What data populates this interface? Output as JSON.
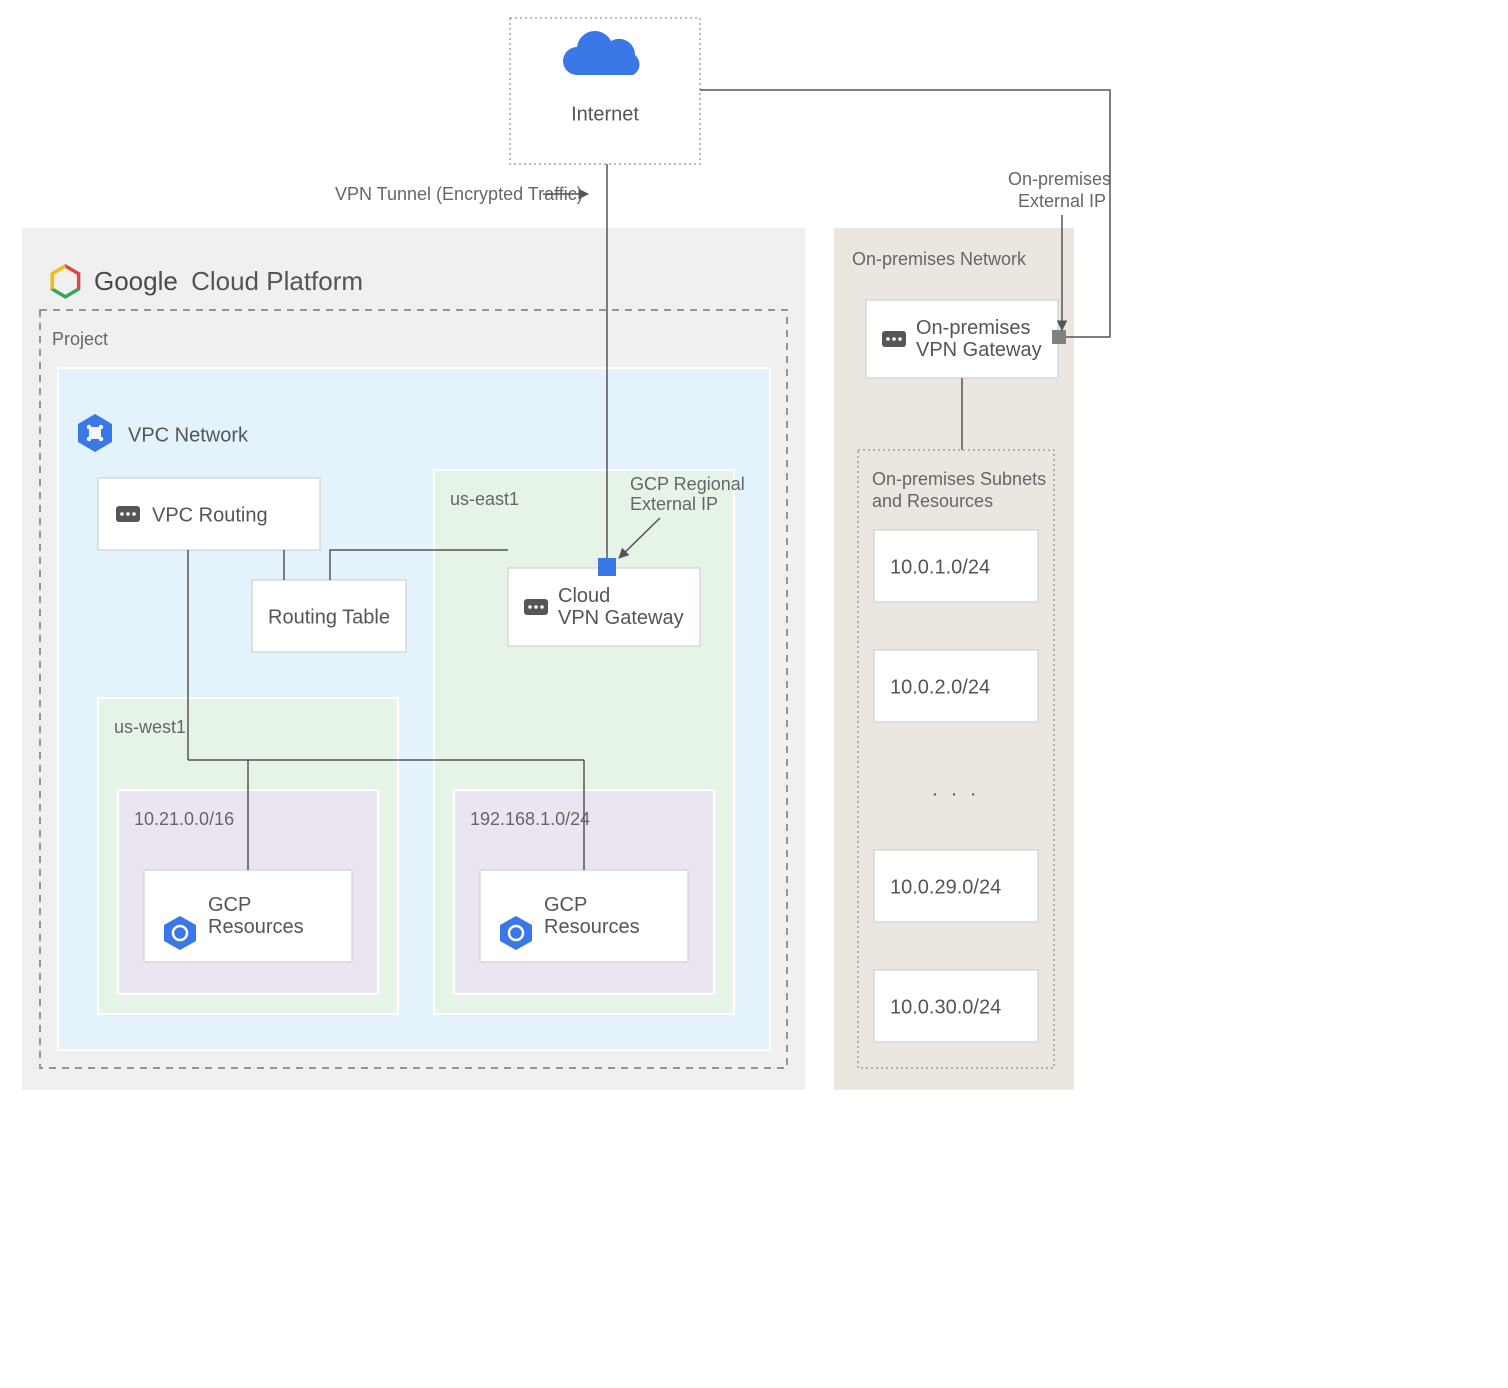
{
  "internet": {
    "label": "Internet"
  },
  "vpn_tunnel_label": "VPN Tunnel (Encrypted Traffic)",
  "gcp": {
    "header_a": "Google",
    "header_b": "Cloud Platform",
    "project_label": "Project",
    "vpc_label": "VPC Network",
    "vpc_routing_label": "VPC Routing",
    "routing_table_label": "Routing Table",
    "region_west": "us-west1",
    "region_east": "us-east1",
    "subnet_west": "10.21.0.0/16",
    "subnet_east": "192.168.1.0/24",
    "resources_west": "GCP\nResources",
    "resources_east": "GCP\nResources",
    "cloud_vpn_gateway": "Cloud\nVPN Gateway",
    "gcp_ext_ip_label": "GCP Regional\nExternal IP"
  },
  "onprem": {
    "header": "On-premises Network",
    "ext_ip_label": "On-premises\nExternal IP",
    "gateway_label": "On-premises\nVPN Gateway",
    "subnets_header": "On-premises Subnets\nand Resources",
    "subnets": [
      "10.0.1.0/24",
      "10.0.2.0/24",
      "10.0.29.0/24",
      "10.0.30.0/24"
    ],
    "ellipsis": ". . ."
  },
  "colors": {
    "gcp_panel": "#f0f0f0",
    "project_dash": "#777",
    "vpc_fill": "#e3f2fb",
    "region_fill": "#e6f3e7",
    "subnet_fill": "#ebe5f2",
    "onprem_fill": "#ebe7e0",
    "blue": "#3b78e7",
    "ellipsis_port": "#818181"
  }
}
